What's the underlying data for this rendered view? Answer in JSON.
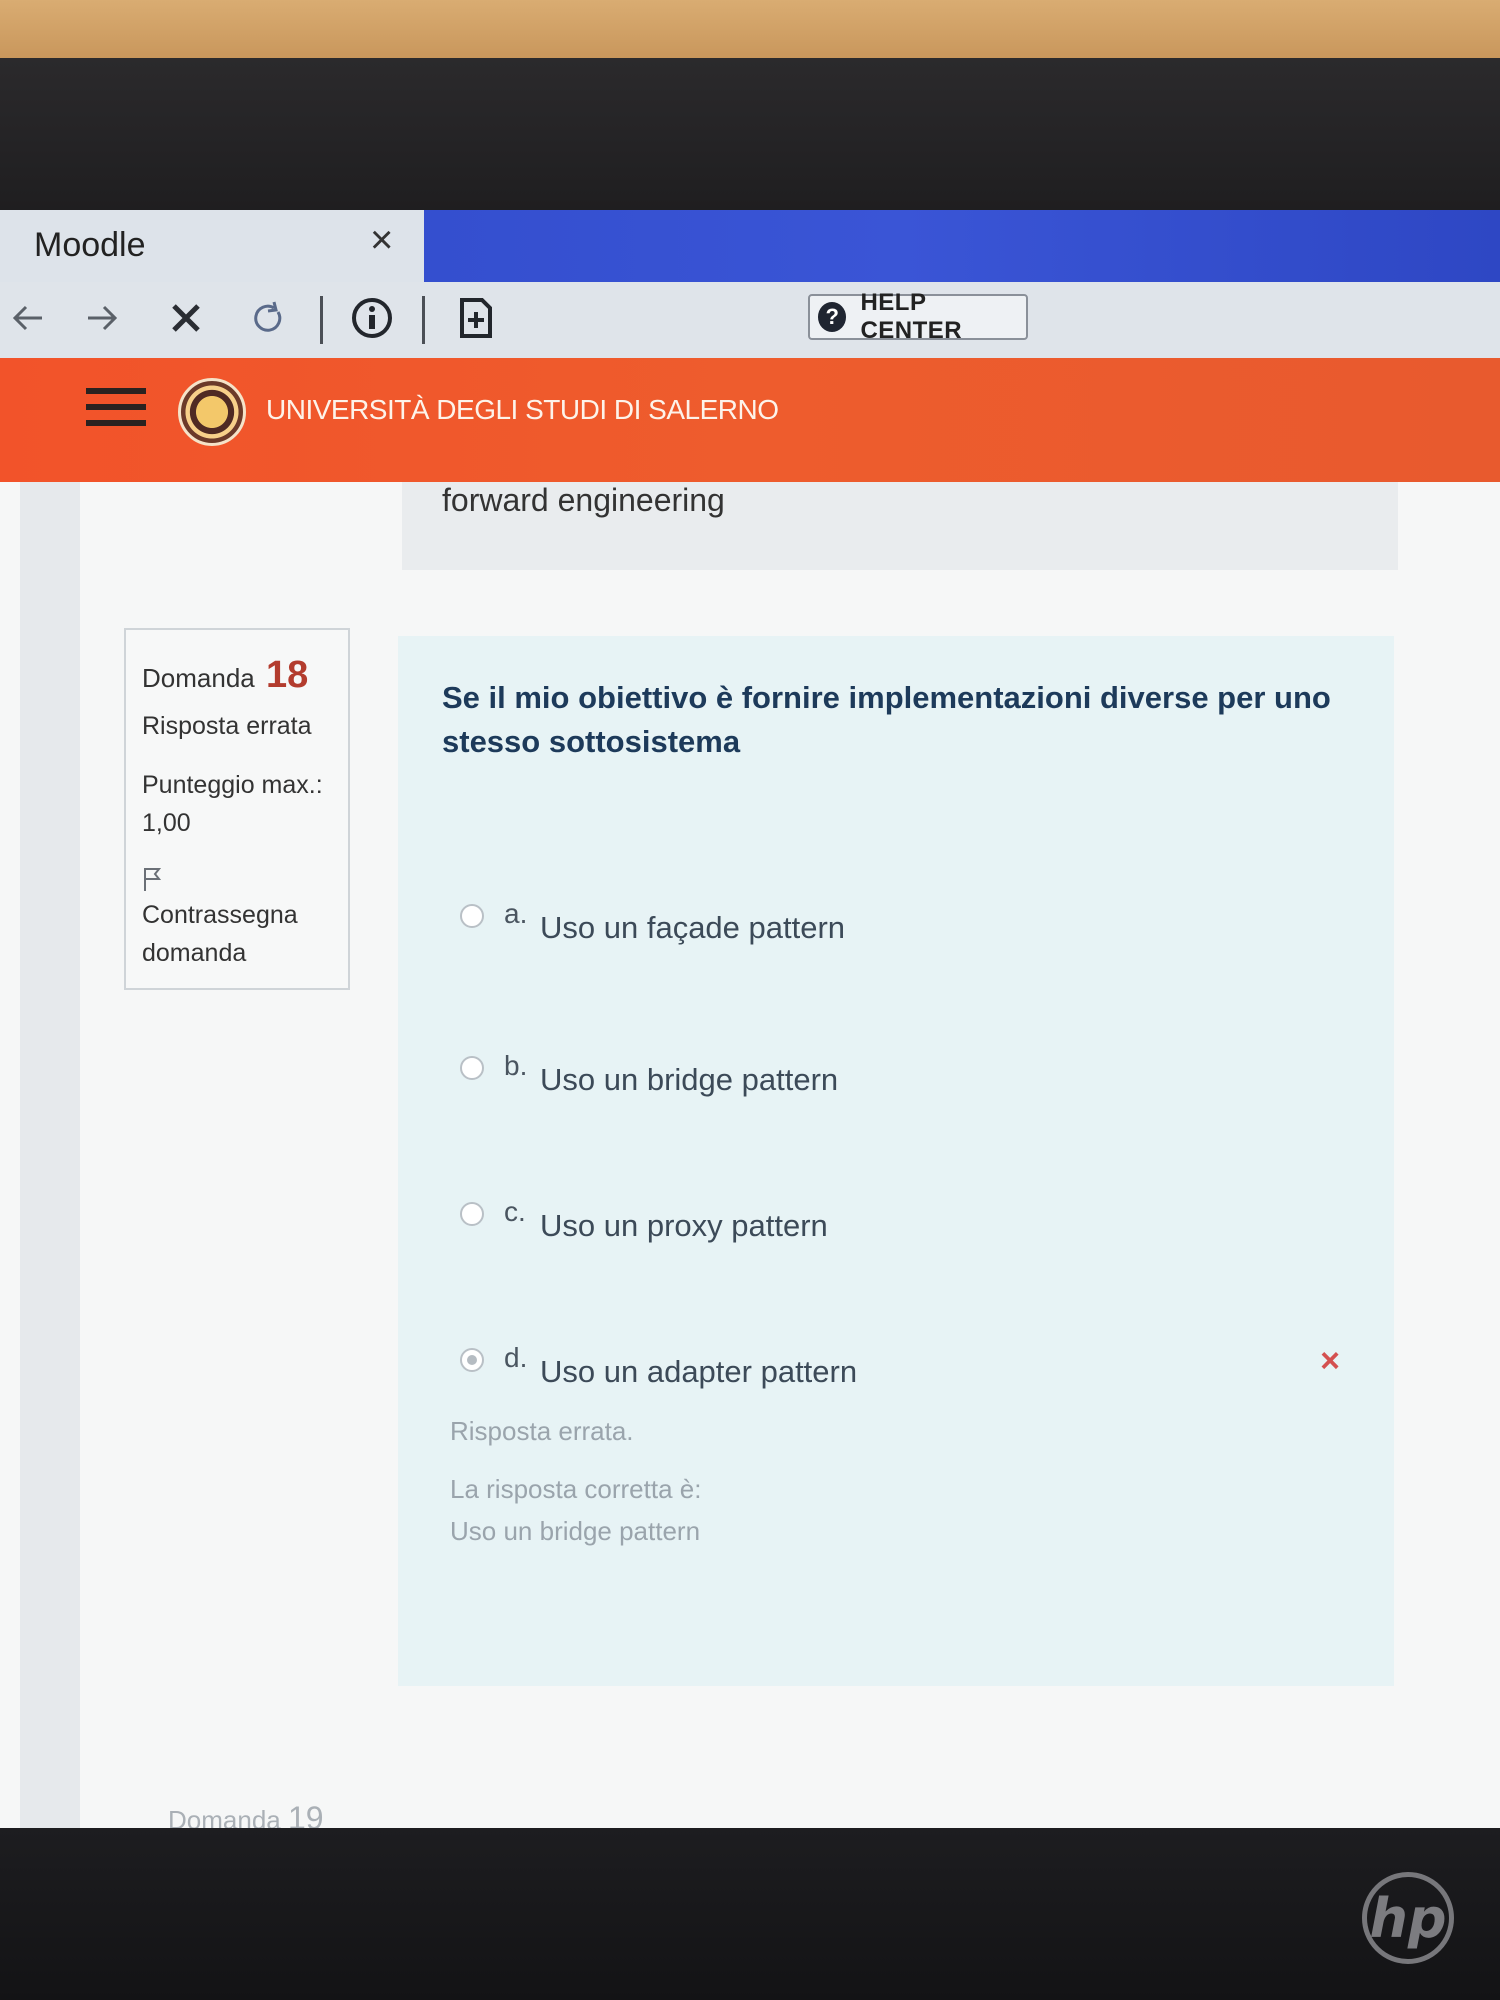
{
  "browser": {
    "tab_title": "Moodle",
    "tab_close_icon": "close-icon",
    "help_center_label": "HELP CENTER"
  },
  "site": {
    "name": "UNIVERSITÀ DEGLI STUDI DI SALERNO"
  },
  "previous_answer": "forward engineering",
  "question": {
    "label": "Domanda",
    "number": "18",
    "state": "Risposta errata",
    "grade": "Punteggio max.: 1,00",
    "flag_label": "Contrassegna domanda",
    "text": "Se il mio obiettivo è fornire implementazioni diverse per uno stesso sottosistema",
    "answers": [
      {
        "letter": "a.",
        "label": "Uso un façade pattern",
        "selected": false
      },
      {
        "letter": "b.",
        "label": "Uso un bridge pattern",
        "selected": false
      },
      {
        "letter": "c.",
        "label": "Uso un proxy pattern",
        "selected": false
      },
      {
        "letter": "d.",
        "label": "Uso un adapter pattern",
        "selected": true
      }
    ],
    "wrong_mark": "×",
    "feedback": {
      "result": "Risposta errata.",
      "correct_prefix": "La risposta corretta è:",
      "correct_answer": "Uso un bridge pattern"
    }
  },
  "next_question": {
    "label": "Domanda",
    "number": "19"
  },
  "colors": {
    "header_orange": "#f2532a",
    "tab_strip_blue": "#3a55d6",
    "question_number_red": "#b33c2e",
    "question_text_blue": "#1d3a5a",
    "card_background": "#e7f3f5"
  }
}
